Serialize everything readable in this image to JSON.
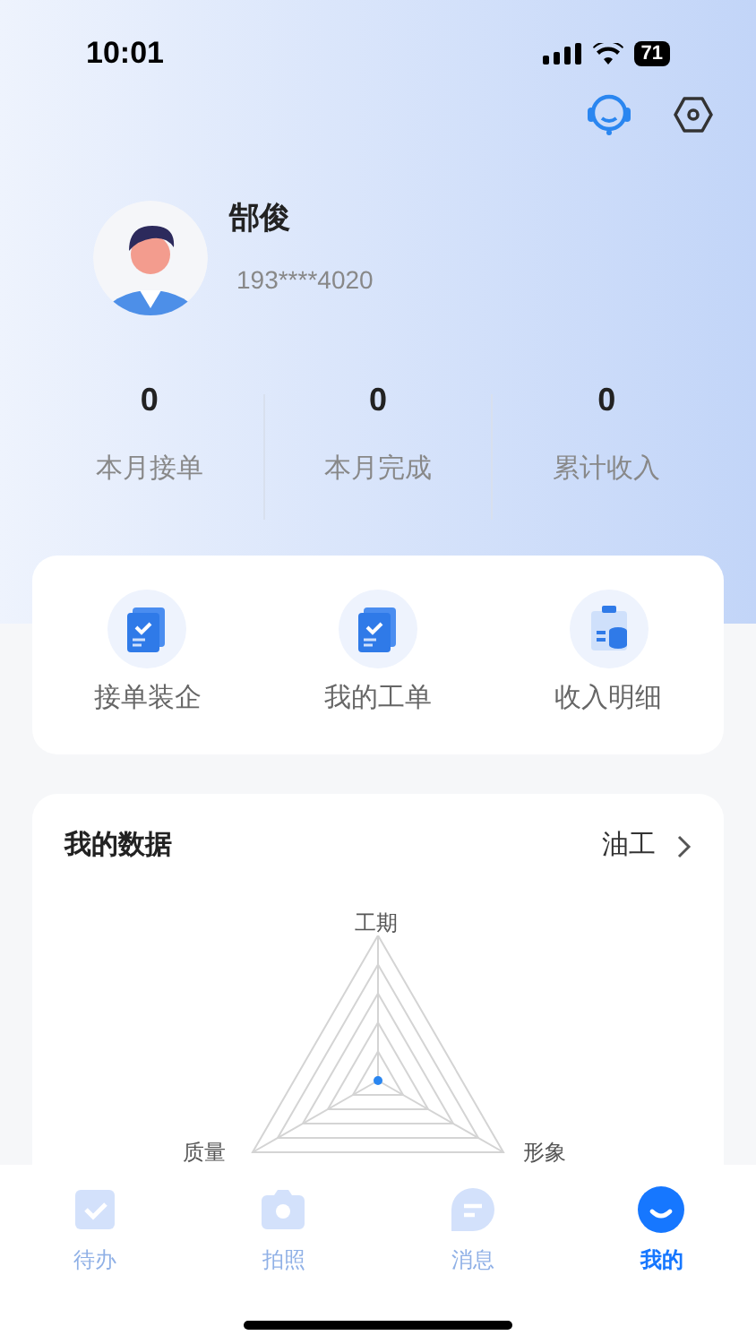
{
  "status_bar": {
    "time": "10:01",
    "battery": "71"
  },
  "profile": {
    "name": "郜俊",
    "phone": "193****4020"
  },
  "stats": [
    {
      "value": "0",
      "label": "本月接单"
    },
    {
      "value": "0",
      "label": "本月完成"
    },
    {
      "value": "0",
      "label": "累计收入"
    }
  ],
  "shortcuts": [
    {
      "label": "接单装企",
      "kind": "doc"
    },
    {
      "label": "我的工单",
      "kind": "doc"
    },
    {
      "label": "收入明细",
      "kind": "income"
    }
  ],
  "data_card": {
    "title": "我的数据",
    "trade": "油工",
    "axes": [
      "工期",
      "质量",
      "形象"
    ]
  },
  "tabs": [
    {
      "label": "待办",
      "kind": "todo",
      "selected": false
    },
    {
      "label": "拍照",
      "kind": "camera",
      "selected": false
    },
    {
      "label": "消息",
      "kind": "message",
      "selected": false
    },
    {
      "label": "我的",
      "kind": "me",
      "selected": true
    }
  ]
}
